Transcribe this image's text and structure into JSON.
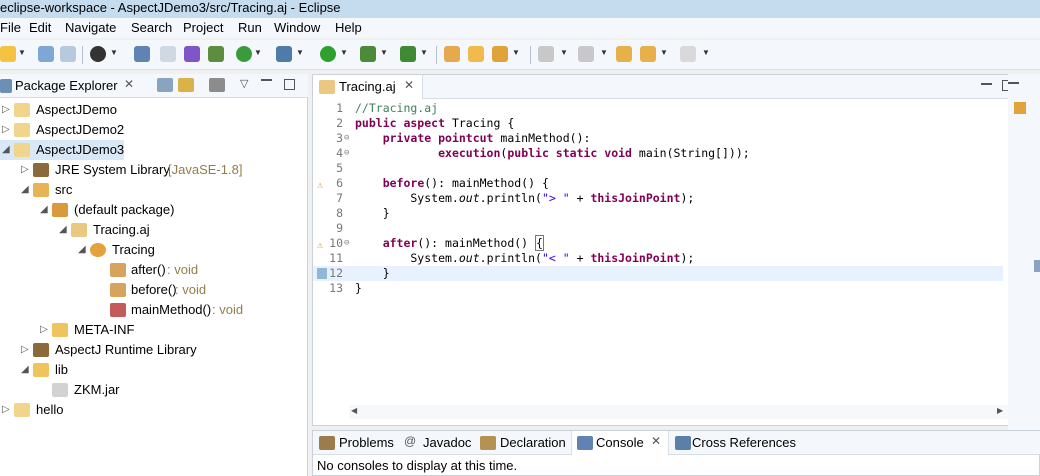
{
  "window": {
    "title": "eclipse-workspace - AspectJDemo3/src/Tracing.aj - Eclipse"
  },
  "menu": [
    "File",
    "Edit",
    "Navigate",
    "Search",
    "Project",
    "Run",
    "Window",
    "Help"
  ],
  "package_explorer": {
    "title": "Package Explorer",
    "items": [
      {
        "label": "AspectJDemo",
        "decoration": ""
      },
      {
        "label": "AspectJDemo2",
        "decoration": ""
      },
      {
        "label": "AspectJDemo3",
        "decoration": ""
      },
      {
        "label": "JRE System Library",
        "decoration": "[JavaSE-1.8]"
      },
      {
        "label": "src",
        "decoration": ""
      },
      {
        "label": "(default package)",
        "decoration": ""
      },
      {
        "label": "Tracing.aj",
        "decoration": ""
      },
      {
        "label": "Tracing",
        "decoration": ""
      },
      {
        "label": "after()",
        "decoration": " : void"
      },
      {
        "label": "before()",
        "decoration": " : void"
      },
      {
        "label": "mainMethod()",
        "decoration": " : void"
      },
      {
        "label": "META-INF",
        "decoration": ""
      },
      {
        "label": "AspectJ Runtime Library",
        "decoration": ""
      },
      {
        "label": "lib",
        "decoration": ""
      },
      {
        "label": "ZKM.jar",
        "decoration": ""
      },
      {
        "label": "hello",
        "decoration": ""
      }
    ]
  },
  "editor": {
    "tab": "Tracing.aj",
    "line_numbers": [
      "1",
      "2",
      "3",
      "4",
      "5",
      "6",
      "7",
      "8",
      "9",
      "10",
      "11",
      "12",
      "13"
    ]
  },
  "console": {
    "tabs": [
      "Problems",
      "Javadoc",
      "Declaration",
      "Console",
      "Cross References"
    ],
    "message": "No consoles to display at this time."
  },
  "colors": {
    "keyword": "#7f0055",
    "comment": "#3f7f5f",
    "string": "#2a00ff",
    "accent": "#c4dcee"
  }
}
